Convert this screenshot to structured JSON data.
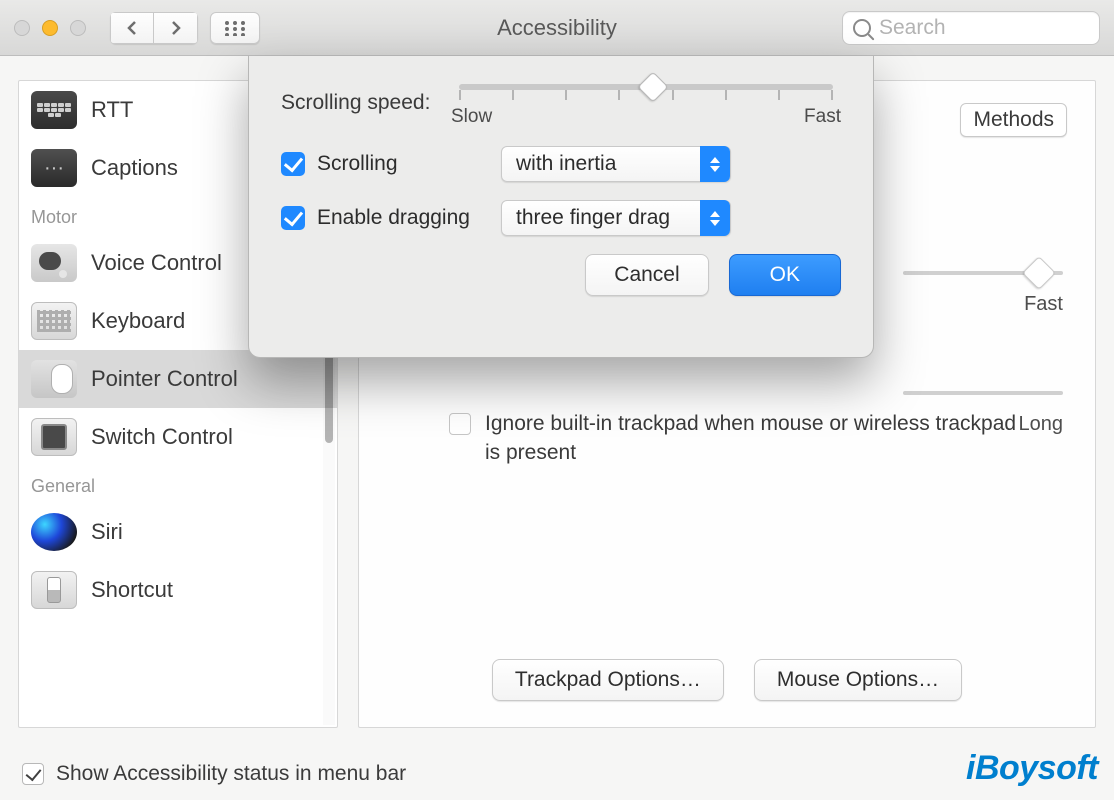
{
  "titlebar": {
    "title": "Accessibility",
    "search_placeholder": "Search"
  },
  "sidebar": {
    "headings": {
      "motor": "Motor",
      "general": "General"
    },
    "items": {
      "rtt": "RTT",
      "captions": "Captions",
      "voice_control": "Voice Control",
      "keyboard": "Keyboard",
      "pointer_control": "Pointer Control",
      "switch_control": "Switch Control",
      "siri": "Siri",
      "shortcut": "Shortcut"
    }
  },
  "content": {
    "tab_peek": "Methods",
    "bg_slider1_label": "Fast",
    "bg_slider2_label": "Long",
    "ignore_text": "Ignore built-in trackpad when mouse or wireless trackpad is present",
    "trackpad_options": "Trackpad Options…",
    "mouse_options": "Mouse Options…"
  },
  "sheet": {
    "scrolling_speed_label": "Scrolling speed:",
    "slow_label": "Slow",
    "fast_label": "Fast",
    "scrolling_checkbox": "Scrolling",
    "scrolling_value": "with inertia",
    "enable_dragging": "Enable dragging",
    "dragging_value": "three finger drag",
    "cancel": "Cancel",
    "ok": "OK"
  },
  "footer": {
    "show_status": "Show Accessibility status in menu bar"
  },
  "watermark": "iBoysoft"
}
